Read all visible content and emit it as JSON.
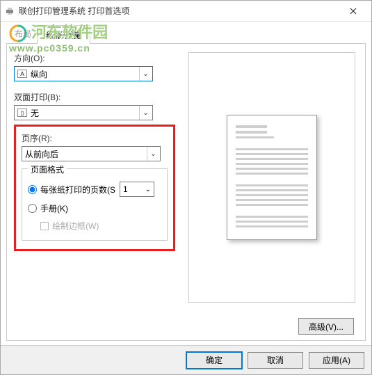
{
  "titlebar": {
    "app_icon": "printer-icon",
    "title": "联创打印管理系统 打印首选项"
  },
  "watermark": {
    "text": "河东软件园",
    "url": "www.pc0359.cn"
  },
  "tabs": {
    "layout_dim": "布局",
    "active": "纸张/质量"
  },
  "orientation": {
    "label": "方向(O):",
    "value": "纵向"
  },
  "duplex": {
    "label": "双面打印(B):",
    "value": "无"
  },
  "page_order": {
    "label": "页序(R):",
    "value": "从前向后"
  },
  "page_format": {
    "legend": "页面格式",
    "pages_per_sheet_label": "每张纸打印的页数(S",
    "pages_per_sheet_value": "1",
    "booklet_label": "手册(K)",
    "draw_border_label": "绘制边框(W)"
  },
  "advanced_btn": "高级(V)...",
  "footer": {
    "ok": "确定",
    "cancel": "取消",
    "apply": "应用(A)"
  }
}
